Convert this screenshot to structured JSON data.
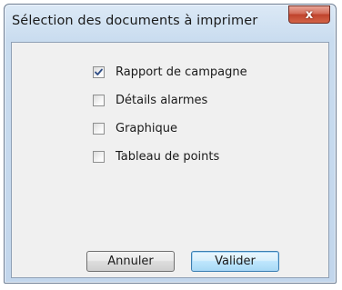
{
  "window": {
    "title": "Sélection des documents à imprimer",
    "close_glyph": "x"
  },
  "options": [
    {
      "label": "Rapport de campagne",
      "checked": true
    },
    {
      "label": "Détails alarmes",
      "checked": false
    },
    {
      "label": "Graphique",
      "checked": false
    },
    {
      "label": "Tableau de points",
      "checked": false
    }
  ],
  "buttons": {
    "cancel_label": "Annuler",
    "ok_label": "Valider"
  },
  "colors": {
    "close_button": "#c94c34",
    "title_bar": "#c9dcef",
    "client_background": "#f0f0f0"
  }
}
